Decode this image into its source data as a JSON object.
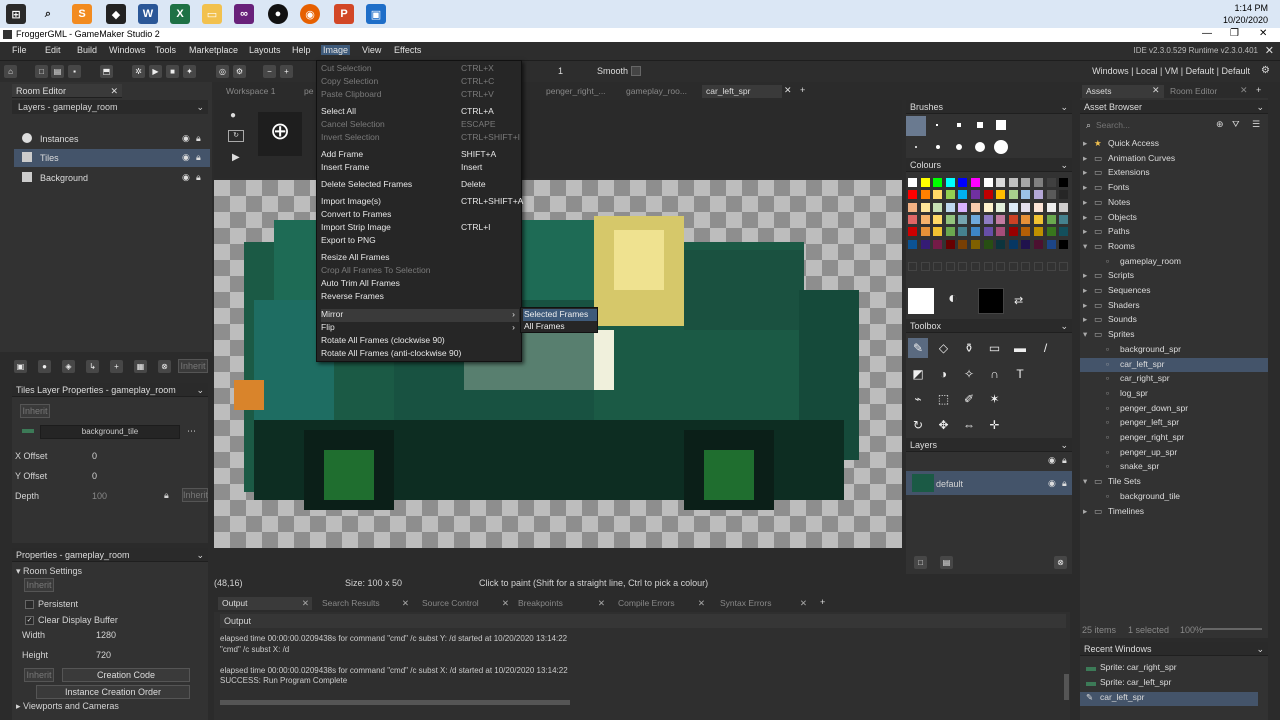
{
  "taskbar": {
    "icons": [
      "windows-icon",
      "search-icon",
      "sublime-icon",
      "unity-icon",
      "word-icon",
      "excel-icon",
      "explorer-icon",
      "visualstudio-icon",
      "github-icon",
      "firefox-icon",
      "powerpoint-icon",
      "gamemaker-icon"
    ],
    "time": "1:14 PM",
    "date": "10/20/2020"
  },
  "window": {
    "title": "FroggerGML - GameMaker Studio 2"
  },
  "menubar": {
    "items": [
      "File",
      "Edit",
      "Build",
      "Windows",
      "Tools",
      "Marketplace",
      "Layouts",
      "Help",
      "Image",
      "View",
      "Effects"
    ],
    "ide_info": "IDE v2.3.0.529  Runtime v2.3.0.401"
  },
  "toolbar": {
    "frame_value": "1",
    "smooth_label": "Smooth",
    "targets": "Windows  |  Local  |  VM  |  Default  |  Default"
  },
  "room_editor": {
    "tab": "Room Editor",
    "layers_header": "Layers - gameplay_room",
    "layers": [
      {
        "name": "Instances"
      },
      {
        "name": "Tiles"
      },
      {
        "name": "Background"
      }
    ],
    "inherit_label": "Inherit"
  },
  "tiles_props": {
    "header": "Tiles Layer Properties - gameplay_room",
    "inherit": "Inherit",
    "tileset": "background_tile",
    "x_offset_label": "X Offset",
    "x_offset": "0",
    "y_offset_label": "Y Offset",
    "y_offset": "0",
    "depth_label": "Depth",
    "depth": "100",
    "inherit2": "Inherit"
  },
  "room_props": {
    "header": "Properties - gameplay_room",
    "settings": "Room Settings",
    "inherit": "Inherit",
    "persistent": "Persistent",
    "clear_display": "Clear Display Buffer",
    "width_label": "Width",
    "width": "1280",
    "height_label": "Height",
    "height": "720",
    "inherit2": "Inherit",
    "creation_code": "Creation Code",
    "instance_order": "Instance Creation Order",
    "viewports": "Viewports and Cameras"
  },
  "editor_tabs": [
    "Workspace 1",
    "pe",
    "penger_right_...",
    "gameplay_roo...",
    "car_left_spr"
  ],
  "image_menu": [
    {
      "label": "Cut Selection",
      "shortcut": "CTRL+X",
      "disabled": true
    },
    {
      "label": "Copy Selection",
      "shortcut": "CTRL+C",
      "disabled": true
    },
    {
      "label": "Paste Clipboard",
      "shortcut": "CTRL+V",
      "disabled": true
    },
    {
      "label": "Select All",
      "shortcut": "CTRL+A",
      "disabled": false
    },
    {
      "label": "Cancel Selection",
      "shortcut": "ESCAPE",
      "disabled": true
    },
    {
      "label": "Invert Selection",
      "shortcut": "CTRL+SHIFT+I",
      "disabled": true
    },
    {
      "label": "Add Frame",
      "shortcut": "SHIFT+A",
      "disabled": false
    },
    {
      "label": "Insert Frame",
      "shortcut": "Insert",
      "disabled": false
    },
    {
      "label": "Delete Selected Frames",
      "shortcut": "Delete",
      "disabled": false
    },
    {
      "label": "Import Image(s)",
      "shortcut": "CTRL+SHIFT+A",
      "disabled": false
    },
    {
      "label": "Convert to Frames",
      "shortcut": "",
      "disabled": false
    },
    {
      "label": "Import Strip Image",
      "shortcut": "CTRL+I",
      "disabled": false
    },
    {
      "label": "Export to PNG",
      "shortcut": "",
      "disabled": false
    },
    {
      "label": "Resize All Frames",
      "shortcut": "",
      "disabled": false
    },
    {
      "label": "Crop All Frames To Selection",
      "shortcut": "",
      "disabled": true
    },
    {
      "label": "Auto Trim All Frames",
      "shortcut": "",
      "disabled": false
    },
    {
      "label": "Reverse Frames",
      "shortcut": "",
      "disabled": false
    },
    {
      "label": "Mirror",
      "shortcut": "",
      "disabled": false
    },
    {
      "label": "Flip",
      "shortcut": "",
      "disabled": false
    },
    {
      "label": "Rotate All Frames (clockwise 90)",
      "shortcut": "",
      "disabled": false
    },
    {
      "label": "Rotate All Frames (anti-clockwise 90)",
      "shortcut": "",
      "disabled": false
    }
  ],
  "submenu": [
    "Selected Frames",
    "All Frames"
  ],
  "status": {
    "coords": "(48,16)",
    "size": "Size: 100 x 50",
    "hint": "Click to paint (Shift for a straight line, Ctrl to pick a colour)"
  },
  "brushes": {
    "header": "Brushes"
  },
  "colours": {
    "header": "Colours"
  },
  "toolbox": {
    "header": "Toolbox"
  },
  "layers_right": {
    "header": "Layers",
    "default_layer": "default"
  },
  "assets": {
    "tabs": [
      "Assets",
      "Room Editor"
    ],
    "browser": "Asset Browser",
    "search_placeholder": "Search...",
    "tree": [
      {
        "label": "Quick Access",
        "indent": 0
      },
      {
        "label": "Animation Curves",
        "indent": 0
      },
      {
        "label": "Extensions",
        "indent": 0
      },
      {
        "label": "Fonts",
        "indent": 0
      },
      {
        "label": "Notes",
        "indent": 0
      },
      {
        "label": "Objects",
        "indent": 0
      },
      {
        "label": "Paths",
        "indent": 0
      },
      {
        "label": "Rooms",
        "indent": 0
      },
      {
        "label": "gameplay_room",
        "indent": 1
      },
      {
        "label": "Scripts",
        "indent": 0
      },
      {
        "label": "Sequences",
        "indent": 0
      },
      {
        "label": "Shaders",
        "indent": 0
      },
      {
        "label": "Sounds",
        "indent": 0
      },
      {
        "label": "Sprites",
        "indent": 0
      },
      {
        "label": "background_spr",
        "indent": 1
      },
      {
        "label": "car_left_spr",
        "indent": 1
      },
      {
        "label": "car_right_spr",
        "indent": 1
      },
      {
        "label": "log_spr",
        "indent": 1
      },
      {
        "label": "penger_down_spr",
        "indent": 1
      },
      {
        "label": "penger_left_spr",
        "indent": 1
      },
      {
        "label": "penger_right_spr",
        "indent": 1
      },
      {
        "label": "penger_up_spr",
        "indent": 1
      },
      {
        "label": "snake_spr",
        "indent": 1
      },
      {
        "label": "Tile Sets",
        "indent": 0
      },
      {
        "label": "background_tile",
        "indent": 1
      },
      {
        "label": "Timelines",
        "indent": 0
      }
    ],
    "count": "25 items",
    "selected": "1 selected",
    "zoom": "100%"
  },
  "recent": {
    "header": "Recent Windows",
    "items": [
      "Sprite: car_right_spr",
      "Sprite: car_left_spr",
      "car_left_spr"
    ]
  },
  "output": {
    "tabs": [
      "Output",
      "Search Results",
      "Source Control",
      "Breakpoints",
      "Compile Errors",
      "Syntax Errors"
    ],
    "sub": "Output",
    "lines": [
      "elapsed time 00:00:00.0209438s for command \"cmd\" /c subst Y: /d started at 10/20/2020 13:14:22",
      "\"cmd\"  /c subst X: /d",
      "",
      "elapsed time 00:00:00.0209438s for command \"cmd\" /c subst X: /d started at 10/20/2020 13:14:22",
      "SUCCESS: Run Program Complete"
    ]
  }
}
